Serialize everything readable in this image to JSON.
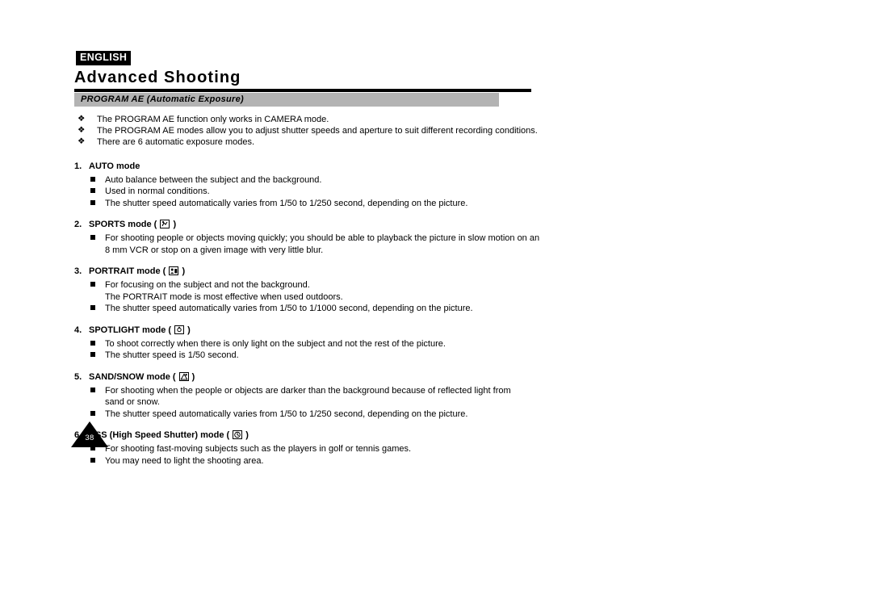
{
  "header": {
    "language_tag": "ENGLISH",
    "chapter_title": "Advanced Shooting",
    "section_bar_label": "PROGRAM AE (Automatic Exposure)"
  },
  "intro_bullets": [
    {
      "marker": "❖",
      "text": "The PROGRAM AE function only works in CAMERA mode."
    },
    {
      "marker": "❖",
      "text": "The PROGRAM AE modes allow you to adjust shutter speeds and aperture to suit different recording conditions."
    },
    {
      "marker": "❖",
      "text": "There are 6 automatic exposure modes."
    }
  ],
  "modes": [
    {
      "number": "1.",
      "name": "AUTO mode",
      "has_icon": false,
      "icon_name": "",
      "items": [
        {
          "bullet": true,
          "text": "Auto balance between the subject and the background."
        },
        {
          "bullet": true,
          "text": "Used in normal conditions."
        },
        {
          "bullet": true,
          "text": "The shutter speed automatically varies from 1/50 to 1/250 second, depending on the picture."
        }
      ]
    },
    {
      "number": "2.",
      "name": "SPORTS mode",
      "has_icon": true,
      "icon_name": "sports-mode-icon",
      "items": [
        {
          "bullet": true,
          "text": "For shooting people or objects moving quickly; you should be able to playback the picture in slow motion on an"
        },
        {
          "bullet": false,
          "text": "8 mm VCR or stop on a given image with very little blur."
        }
      ]
    },
    {
      "number": "3.",
      "name": "PORTRAIT mode",
      "has_icon": true,
      "icon_name": "portrait-mode-icon",
      "items": [
        {
          "bullet": true,
          "text": "For focusing on the subject and not the background."
        },
        {
          "bullet": false,
          "text": "The PORTRAIT mode is most effective when used outdoors."
        },
        {
          "bullet": true,
          "text": "The shutter speed automatically varies from 1/50 to 1/1000 second, depending on the picture."
        }
      ]
    },
    {
      "number": "4.",
      "name": "SPOTLIGHT mode",
      "has_icon": true,
      "icon_name": "spotlight-mode-icon",
      "items": [
        {
          "bullet": true,
          "text": "To shoot correctly when there is only light on the subject and not the rest of the picture."
        },
        {
          "bullet": true,
          "text": "The shutter speed is 1/50 second."
        }
      ]
    },
    {
      "number": "5.",
      "name": "SAND/SNOW mode",
      "has_icon": true,
      "icon_name": "sand-snow-mode-icon",
      "items": [
        {
          "bullet": true,
          "text": "For shooting when the people or objects are darker than the background because of reflected light from"
        },
        {
          "bullet": false,
          "text": "sand or snow."
        },
        {
          "bullet": true,
          "text": "The shutter speed automatically varies from 1/50 to 1/250 second, depending on the picture."
        }
      ]
    },
    {
      "number": "6.",
      "name": "HSS (High Speed Shutter) mode",
      "has_icon": true,
      "icon_name": "hss-mode-icon",
      "items": [
        {
          "bullet": true,
          "text": "For shooting fast-moving subjects such as the players in golf or tennis games."
        },
        {
          "bullet": true,
          "text": "You may need to light the shooting area."
        }
      ]
    }
  ],
  "footer": {
    "page_number": "38"
  },
  "colors": {
    "section_bar": "#b3b3b3",
    "rule": "#000000",
    "text": "#000000"
  }
}
